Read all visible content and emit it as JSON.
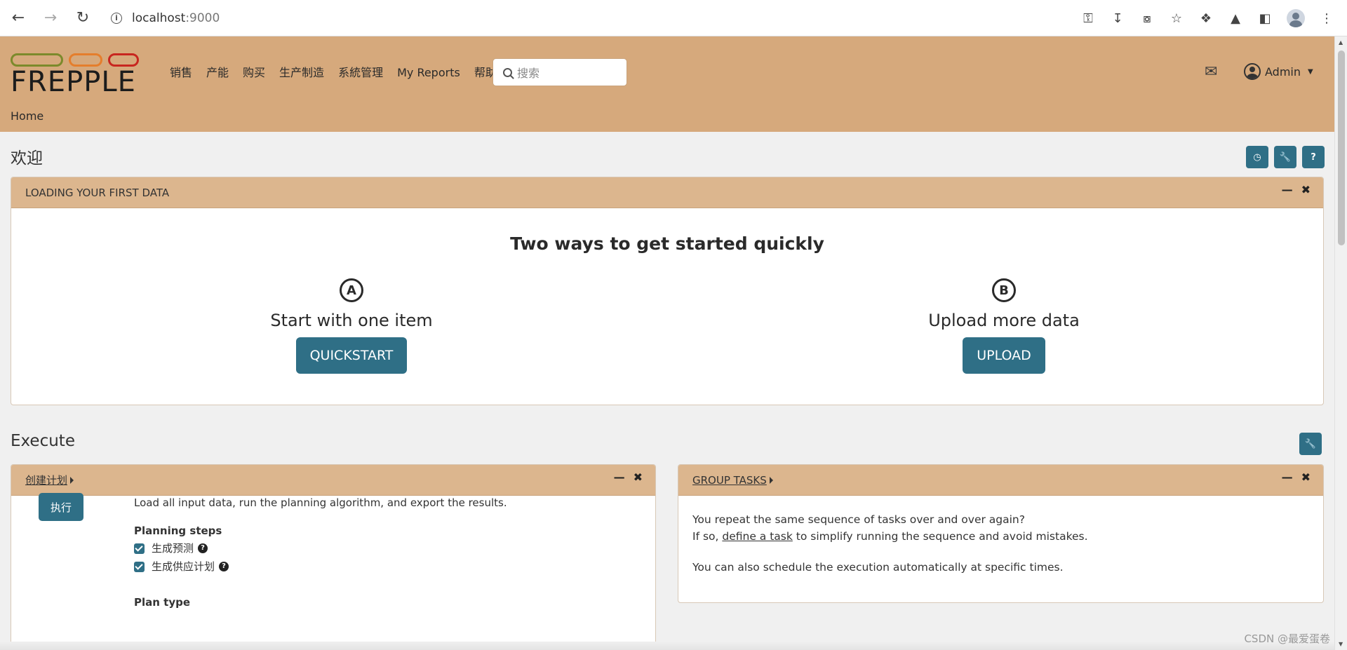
{
  "browser": {
    "url_host": "localhost",
    "url_port": ":9000"
  },
  "app": {
    "logo_text": "FREPPLE",
    "menu": [
      "销售",
      "产能",
      "购买",
      "生产制造",
      "系統管理",
      "My Reports",
      "帮助"
    ],
    "search_placeholder": "搜索",
    "user_label": "Admin",
    "breadcrumb": "Home"
  },
  "welcome": {
    "title": "欢迎",
    "panel_title": "LOADING YOUR FIRST DATA",
    "headline": "Two ways to get started quickly",
    "option_a": {
      "letter": "A",
      "title": "Start with one item",
      "button": "QUICKSTART"
    },
    "option_b": {
      "letter": "B",
      "title": "Upload more data",
      "button": "UPLOAD"
    }
  },
  "execute": {
    "title": "Execute",
    "plan_panel": {
      "title": "创建计划",
      "run_button": "执行",
      "description": "Load all input data, run the planning algorithm, and export the results.",
      "steps_label": "Planning steps",
      "steps": [
        "生成预测",
        "生成供应计划"
      ],
      "plan_type_label": "Plan type"
    },
    "group_panel": {
      "title": "GROUP TASKS",
      "line1": "You repeat the same sequence of tasks over and over again?",
      "line2_pre": "If so, ",
      "line2_link": "define a task",
      "line2_post": " to simplify running the sequence and avoid mistakes.",
      "line3": "You can also schedule the execution automatically at specific times."
    }
  },
  "watermark": "CSDN @最爱蛋卷",
  "colors": {
    "header_bg": "#d6a97c",
    "panel_header_bg": "#dcb68e",
    "accent": "#2f6f86"
  }
}
